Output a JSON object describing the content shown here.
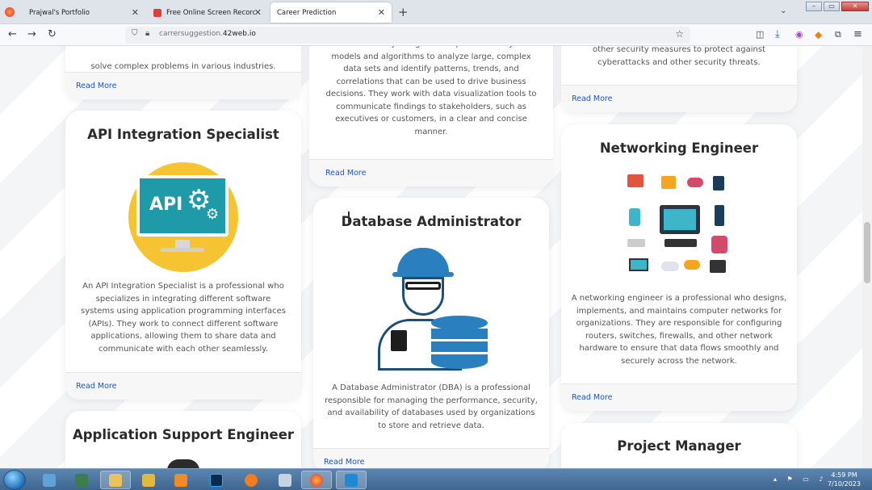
{
  "browser": {
    "tabs": [
      {
        "label": "Prajwal's Portfolio",
        "active": false
      },
      {
        "label": "Free Online Screen Recorder &",
        "active": false
      },
      {
        "label": "Career Prediction",
        "active": true
      }
    ],
    "url_prefix": "carrersuggestion.",
    "url_domain": "42web.io"
  },
  "cards": {
    "card1_tail": "solve complex problems in various industries.",
    "card1_read_more": "Read More",
    "data_scientist_tail": "from data. They design and implement analytical models and algorithms to analyze large, complex data sets and identify patterns, trends, and correlations that can be used to drive business decisions. They work with data visualization tools to communicate findings to stakeholders, such as executives or customers, in a clear and concise manner.",
    "data_scientist_read_more": "Read More",
    "security_tail": "other security measures to protect against cyberattacks and other security threats.",
    "security_read_more": "Read More",
    "api_title": "API Integration Specialist",
    "api_icon_text": "API",
    "api_desc": "An API Integration Specialist is a professional who specializes in integrating different software systems using application programming interfaces (APIs). They work to connect different software applications, allowing them to share data and communicate with each other seamlessly.",
    "api_read_more": "Read More",
    "dba_title": "Database Administrator",
    "dba_desc": "A Database Administrator (DBA) is a professional responsible for managing the performance, security, and availability of databases used by organizations to store and retrieve data.",
    "dba_read_more": "Read More",
    "network_title": "Networking Engineer",
    "network_desc": "A networking engineer is a professional who designs, implements, and maintains computer networks for organizations. They are responsible for configuring routers, switches, firewalls, and other network hardware to ensure that data flows smoothly and securely across the network.",
    "network_read_more": "Read More",
    "app_support_title": "Application Support Engineer",
    "pm_title": "Project Manager"
  },
  "taskbar": {
    "time": "4:59 PM",
    "date": "7/10/2023"
  },
  "colors": {
    "link": "#1a56c9",
    "api_circle": "#f6c433",
    "api_screen": "#1f9aa8",
    "dba_blue": "#2a7fbf",
    "taskbar": "#4a72a0"
  }
}
